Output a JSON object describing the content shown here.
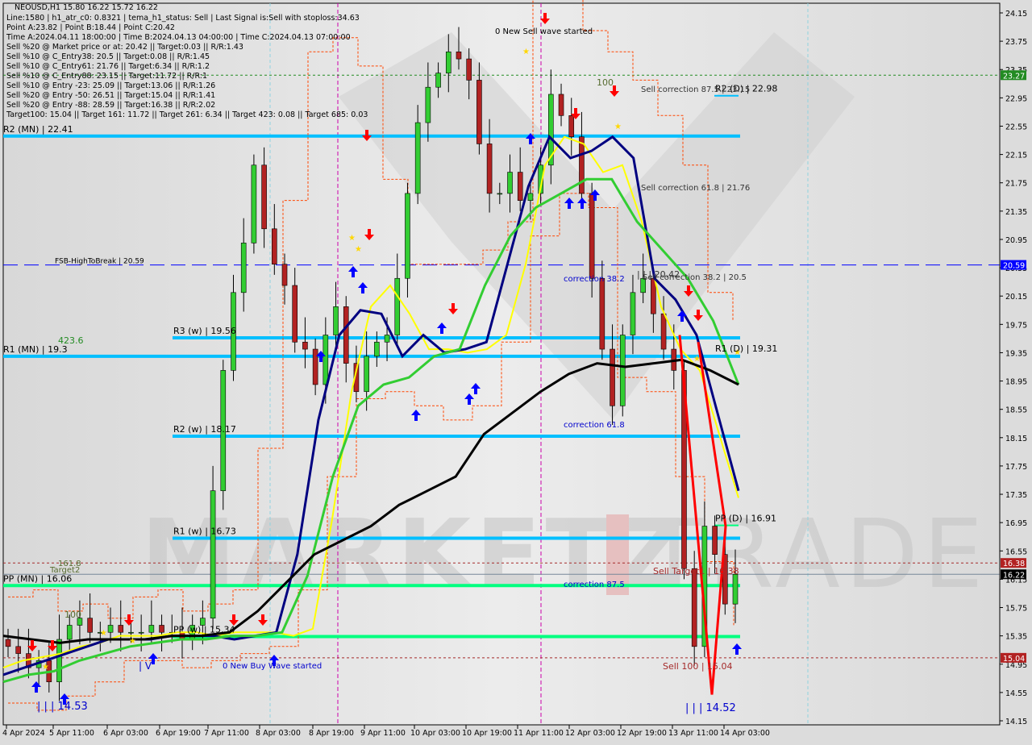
{
  "header": {
    "title": "NEOUSD,H1  15.80 16.22 15.72 16.22",
    "info_lines": [
      "Line:1580 | h1_atr_c0: 0.8321 | tema_h1_status: Sell | Last Signal is:Sell with stoploss:34.63",
      "Point A:23.82 | Point B:18.44 | Point C:20.42",
      "Time A:2024.04.11 18:00:00 | Time B:2024.04.13 04:00:00 | Time C:2024.04.13 07:00:00",
      "Sell %20 @ Market price or at: 20.42 || Target:0.03 || R/R:1.43",
      "Sell %10 @ C_Entry38: 20.5 || Target:0.08 || R/R:1.45",
      "Sell %10 @ C_Entry61: 21.76 || Target:6.34 || R/R:1.2",
      "Sell %10 @ C_Entry88: 23.15 || Target:11.72 || R/R:1",
      "Sell %10 @ Entry -23: 25.09 || Target:13.06 || R/R:1.26",
      "Sell %20 @ Entry -50: 26.51 || Target:15.04 || R/R:1.41",
      "Sell %20 @ Entry -88: 28.59 || Target:16.38 || R/R:2.02",
      "Target100: 15.04 || Target 161: 11.72 || Target 261: 6.34 || Target 423: 0.08 || Target 685: 0.03"
    ]
  },
  "colors": {
    "background": "#dcdcdc",
    "pivot_blue": "#00bfff",
    "pivot_green": "#00ff7f",
    "bull_candle": "#32cd32",
    "bear_candle": "#b22222",
    "sell_target": "#a52a2a",
    "ema_yellow": "#ffff00",
    "ema_navy": "#000080",
    "ema_green": "#32cd32",
    "sma_black": "#000000",
    "fsb_blue": "#0000ff",
    "price_badge_black": "#000000",
    "price_badge_red": "#b22222",
    "price_badge_green": "#228b22",
    "price_badge_blue": "#0000ff",
    "watermark": "#c8c8c8"
  },
  "watermark": {
    "left": "MARKETZ",
    "right": "TRADE"
  },
  "chart_data": {
    "type": "candlestick",
    "symbol": "NEOUSD",
    "timeframe": "H1",
    "ohlc_last": {
      "open": 15.8,
      "high": 16.22,
      "low": 15.72,
      "close": 16.22
    },
    "ylim": [
      14.15,
      24.15
    ],
    "y_ticks": [
      "24.15",
      "23.75",
      "23.35",
      "22.95",
      "22.55",
      "22.15",
      "21.75",
      "21.35",
      "20.95",
      "20.55",
      "20.15",
      "19.75",
      "19.35",
      "18.95",
      "18.55",
      "18.15",
      "17.75",
      "17.35",
      "16.95",
      "16.55",
      "16.15",
      "15.75",
      "15.35",
      "14.95",
      "14.55",
      "14.15"
    ],
    "x_ticks": [
      "4 Apr 2024",
      "5 Apr 11:00",
      "6 Apr 03:00",
      "6 Apr 19:00",
      "7 Apr 11:00",
      "8 Apr 03:00",
      "8 Apr 19:00",
      "9 Apr 11:00",
      "10 Apr 03:00",
      "10 Apr 19:00",
      "11 Apr 11:00",
      "12 Apr 03:00",
      "12 Apr 19:00",
      "13 Apr 11:00",
      "14 Apr 03:00"
    ],
    "price_badges": [
      {
        "value": "23.27",
        "style": "green"
      },
      {
        "value": "20.59",
        "style": "blue"
      },
      {
        "value": "16.38",
        "style": "red"
      },
      {
        "value": "16.22",
        "style": "black"
      },
      {
        "value": "15.04",
        "style": "red"
      }
    ],
    "levels": [
      {
        "label": "R2 (MN) | 22.41",
        "value": 22.41,
        "kind": "monthly",
        "color": "blue"
      },
      {
        "label": "R1 (MN) | 19.3",
        "value": 19.3,
        "kind": "monthly",
        "color": "blue"
      },
      {
        "label": "PP (MN) | 16.06",
        "value": 16.06,
        "kind": "monthly",
        "color": "green"
      },
      {
        "label": "R3 (w) | 19.56",
        "value": 19.56,
        "kind": "weekly",
        "color": "blue"
      },
      {
        "label": "R2 (w) | 18.17",
        "value": 18.17,
        "kind": "weekly",
        "color": "blue"
      },
      {
        "label": "R1 (w) | 16.73",
        "value": 16.73,
        "kind": "weekly",
        "color": "blue"
      },
      {
        "label": "PP (w) | 15.34",
        "value": 15.34,
        "kind": "weekly",
        "color": "green"
      },
      {
        "label": "R2 (D) | 22.98",
        "value": 22.98,
        "kind": "daily",
        "color": "blue"
      },
      {
        "label": "R1 (D) | 19.31",
        "value": 19.31,
        "kind": "daily",
        "color": "blue"
      },
      {
        "label": "PP (D) | 16.91",
        "value": 16.91,
        "kind": "daily",
        "color": "green"
      }
    ],
    "dashed_lines": [
      {
        "label": "FSB-HighToBreak | 20.59",
        "value": 20.59,
        "color": "blue"
      },
      {
        "label": "",
        "value": 23.27,
        "color": "green"
      },
      {
        "label": "Sell Target1 | 16.38",
        "value": 16.38,
        "color": "red"
      },
      {
        "label": "Sell 100 | 15.04",
        "value": 15.04,
        "color": "red"
      }
    ],
    "annotations": [
      {
        "text": "0 New Sell wave started",
        "x": "11 Apr 11:00",
        "y": 23.9
      },
      {
        "text": "0 New Buy Wave started",
        "x": "8 Apr 03:00",
        "y": 15.1
      },
      {
        "text": "Sell correction 87.5 | 23.15",
        "x": "13 Apr 03:00",
        "y": 22.98
      },
      {
        "text": "Sell correction 61.8 | 21.76",
        "x": "13 Apr 03:00",
        "y": 21.76
      },
      {
        "text": "Sell correction 38.2 | 20.5",
        "x": "13 Apr 03:00",
        "y": 20.5
      },
      {
        "text": "correction 38.2",
        "x": "11 Apr 19:00",
        "y": 20.5
      },
      {
        "text": "correction 61.8",
        "x": "11 Apr 19:00",
        "y": 18.3
      },
      {
        "text": "correction 87.5",
        "x": "11 Apr 19:00",
        "y": 16.1
      },
      {
        "text": "| | | 14.53",
        "x": "5 Apr 03:00",
        "y": 14.5
      },
      {
        "text": "| | | 14.52",
        "x": "13 Apr 19:00",
        "y": 14.5
      },
      {
        "text": "| | | 20.42",
        "x": "13 Apr 03:00",
        "y": 20.5
      },
      {
        "text": "| V",
        "x": "6 Apr 11:00",
        "y": 15.0
      },
      {
        "text": "423.6",
        "x": "4 Apr 23:00",
        "y": 19.4
      },
      {
        "text": "161.8",
        "x": "4 Apr 23:00",
        "y": 16.38
      },
      {
        "text": "Target2",
        "x": "4 Apr 23:00",
        "y": 16.28
      },
      {
        "text": "100",
        "x": "5 Apr 03:00",
        "y": 15.8
      },
      {
        "text": "100",
        "x": "12 Apr 03:00",
        "y": 23.0
      }
    ],
    "series": [
      {
        "name": "Close (approx.)",
        "type": "candles",
        "values": [
          15.2,
          15.1,
          14.9,
          15.0,
          14.7,
          15.3,
          15.5,
          15.6,
          15.4,
          15.4,
          15.5,
          15.4,
          15.4,
          15.4,
          15.5,
          15.4,
          15.4,
          15.3,
          15.5,
          15.6,
          17.4,
          19.1,
          20.2,
          20.9,
          22.0,
          21.1,
          20.6,
          20.3,
          19.5,
          19.4,
          18.9,
          19.6,
          20.0,
          19.2,
          18.8,
          19.3,
          19.5,
          19.6,
          20.4,
          21.6,
          22.6,
          23.1,
          23.3,
          23.6,
          23.5,
          23.2,
          22.3,
          21.6,
          21.6,
          21.9,
          21.5,
          21.6,
          22.0,
          23.0,
          22.7,
          22.4,
          21.6,
          20.4,
          19.4,
          18.6,
          19.6,
          20.2,
          20.4,
          19.9,
          19.4,
          19.1,
          16.3,
          15.2,
          16.9,
          16.5,
          15.8,
          16.22
        ]
      },
      {
        "name": "EMA fast (yellow)",
        "type": "line",
        "values": [
          14.9,
          15.0,
          15.05,
          15.1,
          15.2,
          15.25,
          15.35,
          15.35,
          15.35,
          15.4,
          15.4,
          15.35,
          15.4,
          15.4,
          15.4,
          15.35,
          15.45,
          17.0,
          18.8,
          20.0,
          20.3,
          19.9,
          19.4,
          19.4,
          19.35,
          19.4,
          19.6,
          20.6,
          22.0,
          22.4,
          22.3,
          21.9,
          22.0,
          21.2,
          20.0,
          19.4,
          19.1,
          18.2,
          17.3
        ]
      },
      {
        "name": "EMA mid (navy)",
        "type": "line",
        "values": [
          14.8,
          14.9,
          15.0,
          15.1,
          15.2,
          15.3,
          15.3,
          15.3,
          15.35,
          15.35,
          15.35,
          15.3,
          15.35,
          15.4,
          16.5,
          18.4,
          19.6,
          19.95,
          19.9,
          19.3,
          19.6,
          19.35,
          19.4,
          19.5,
          20.6,
          21.7,
          22.4,
          22.1,
          22.2,
          22.4,
          22.1,
          20.4,
          20.1,
          19.6,
          18.5,
          17.4
        ]
      },
      {
        "name": "EMA slow (green)",
        "type": "line",
        "values": [
          14.7,
          14.8,
          14.85,
          15.0,
          15.1,
          15.2,
          15.25,
          15.3,
          15.3,
          15.35,
          15.35,
          15.4,
          16.2,
          17.6,
          18.6,
          18.9,
          19.0,
          19.3,
          19.4,
          20.3,
          21.0,
          21.4,
          21.6,
          21.8,
          21.8,
          21.2,
          20.8,
          20.4,
          19.8,
          18.9
        ]
      },
      {
        "name": "SMA long (black)",
        "type": "line",
        "values": [
          15.35,
          15.3,
          15.25,
          15.3,
          15.3,
          15.3,
          15.35,
          15.35,
          15.4,
          15.7,
          16.1,
          16.5,
          16.7,
          16.9,
          17.2,
          17.4,
          17.6,
          18.2,
          18.5,
          18.8,
          19.05,
          19.2,
          19.15,
          19.2,
          19.25,
          19.1,
          18.9
        ]
      }
    ]
  }
}
